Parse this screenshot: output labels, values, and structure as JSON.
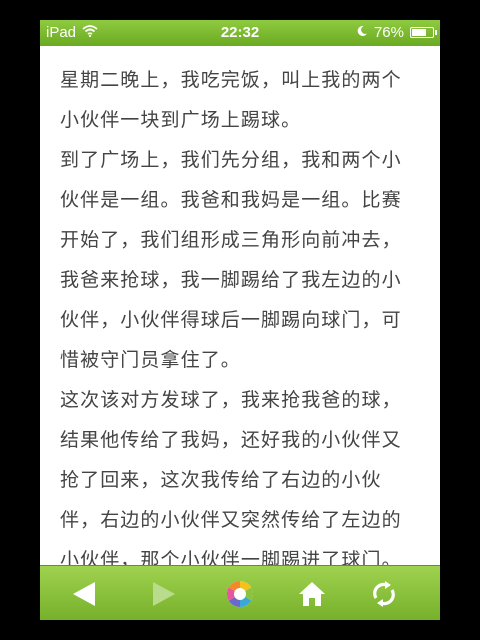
{
  "status_bar": {
    "device": "iPad",
    "time": "22:32",
    "battery": "76%",
    "battery_level": 0.76,
    "icons": [
      "wifi-icon",
      "moon-icon",
      "battery-icon"
    ]
  },
  "article": {
    "paragraphs": [
      "星期二晚上，我吃完饭，叫上我的两个小伙伴一块到广场上踢球。",
      "到了广场上，我们先分组，我和两个小伙伴是一组。我爸和我妈是一组。比赛开始了，我们组形成三角形向前冲去，我爸来抢球，我一脚踢给了我左边的小伙伴，小伙伴得球后一脚踢向球门，可惜被守门员拿住了。",
      "这次该对方发球了，我来抢我爸的球，结果他传给了我妈，还好我的小伙伴又抢了回来，这次我传给了右边的小伙伴，右边的小伙伴又突然传给了左边的小伙伴，那个小伙伴一脚踢进了球门。"
    ]
  },
  "toolbar": {
    "buttons": [
      "back-icon",
      "forward-icon",
      "share-icon",
      "home-icon",
      "refresh-icon"
    ]
  },
  "colors": {
    "bar_green": "#8fcb40",
    "text": "#444444",
    "disabled": "#b9dc8c"
  }
}
